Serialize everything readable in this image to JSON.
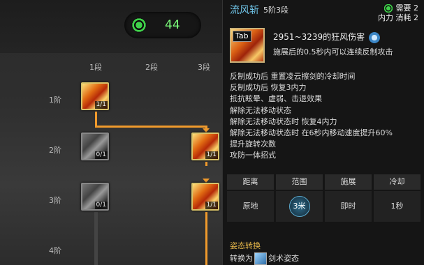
{
  "points": {
    "value": "44",
    "icon": "green-orb-icon"
  },
  "tree": {
    "columns": [
      "1段",
      "2段",
      "3段"
    ],
    "rows": [
      "1阶",
      "2阶",
      "3阶",
      "4阶"
    ],
    "nodes": [
      {
        "id": "r1c1",
        "level": "1/1",
        "state": "active"
      },
      {
        "id": "r2c1",
        "level": "0/1",
        "state": "inactive"
      },
      {
        "id": "r2c3",
        "level": "1/1",
        "state": "active"
      },
      {
        "id": "r3c1",
        "level": "0/1",
        "state": "inactive"
      },
      {
        "id": "r3c3",
        "level": "1/1",
        "state": "active"
      }
    ]
  },
  "skill": {
    "name": "流风斩",
    "level": "5阶3段",
    "requirement_label": "需要",
    "requirement_value": "2",
    "cost_label": "内力 消耗",
    "cost_value": "2",
    "key": "Tab",
    "damage": "2951~3239的狂风伤害",
    "desc": "施展后的0.5秒内可以连续反制攻击",
    "effects": [
      "反制成功后 重置凌云擦剑的冷却时间",
      "反制成功后 恢复3内力",
      "抵抗眩晕、虚弱、击退效果",
      "解除无法移动状态",
      "解除无法移动状态时 恢复4内力",
      "解除无法移动状态时 在6秒内移动速度提升60%",
      "提升旋转次数",
      "攻防一体招式"
    ],
    "table": {
      "headers": [
        "距离",
        "范围",
        "施展",
        "冷却"
      ],
      "values": [
        "原地",
        "3米",
        "即时",
        "1秒"
      ]
    },
    "stance_title": "姿态转换",
    "stance_prefix": "转换为",
    "stance_name": "剑术姿态"
  },
  "colors": {
    "accent": "#f09a2c",
    "name": "#6fc3e6",
    "points": "#7cff7c",
    "stance": "#e8b84a"
  }
}
